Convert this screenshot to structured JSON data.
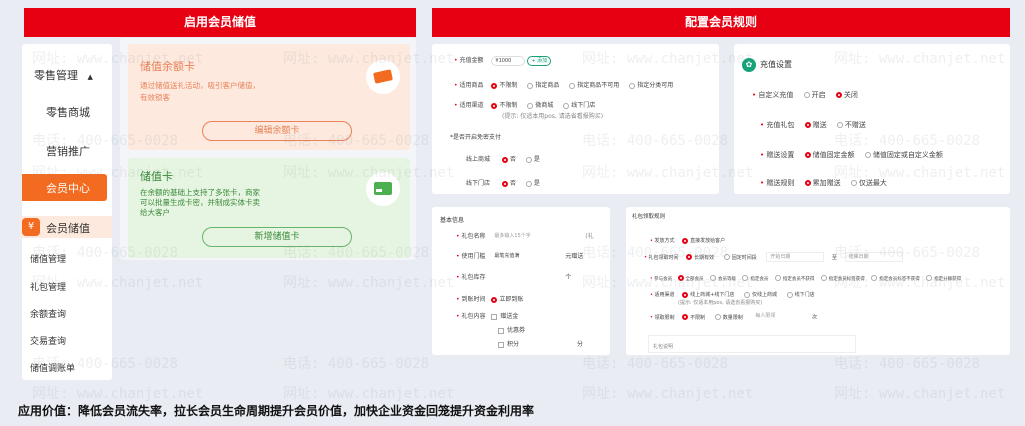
{
  "banners": {
    "left": "启用会员储值",
    "right": "配置会员规则"
  },
  "watermark": {
    "url": "网址: www.chanjet.net",
    "phone": "电话: 400-665-0028"
  },
  "sidebar": {
    "group": "零售管理",
    "items": [
      "零售商城",
      "营销推广",
      "会员中心"
    ],
    "section": "会员储值",
    "sub_items": [
      "储值管理",
      "礼包管理",
      "余额查询",
      "交易查询",
      "储值调账单"
    ]
  },
  "cards": {
    "balance": {
      "title": "储值余额卡",
      "desc1": "通过储值送礼活动，吸引客户储值，",
      "desc2": "有效锁客",
      "button": "编辑余额卡"
    },
    "stored": {
      "title": "储值卡",
      "desc1": "在余额的基础上支持了多张卡，商家",
      "desc2": "可以批量生成卡密，并制成实体卡卖",
      "desc3": "给大客户",
      "button": "新增储值卡"
    }
  },
  "recharge_form": {
    "amount_label": "充值金额",
    "amount_value": "¥1000",
    "add_label": "+ 添加",
    "goods_label": "适用商品",
    "goods_options": [
      "不限制",
      "指定商品",
      "指定商品不可用",
      "指定分类可用"
    ],
    "channel_label": "适用渠道",
    "channel_options": [
      "不限制",
      "微商城",
      "线下门店"
    ],
    "channel_tip": "(提示: 仅适本用pos, 请选省看报购买)",
    "free_pay_label": "*是否开启免密支付",
    "online_label": "线上商城",
    "offline_label": "线下门店",
    "yes": "否",
    "no": "是"
  },
  "settings": {
    "title": "充值设置",
    "custom_label": "自定义充值",
    "custom_options": [
      "开启",
      "关闭"
    ],
    "gift_label": "充值礼包",
    "gift_options": [
      "赠送",
      "不赠送"
    ],
    "gift_setting_label": "赠送设置",
    "gift_setting_options": [
      "储值固定金额",
      "储值固定或自定义金额"
    ],
    "gift_rule_label": "赠送规则",
    "gift_rule_options": [
      "累加赠送",
      "仅送最大"
    ]
  },
  "basic_info": {
    "title": "基本信息",
    "name_label": "礼包名称",
    "name_placeholder": "最多输入15个字",
    "name_hint": "(礼",
    "threshold_label": "使用门槛",
    "threshold_value": "最笔充值满",
    "threshold_unit": "元赠送",
    "stock_label": "礼包库存",
    "stock_unit": "个",
    "arrive_label": "到账时间",
    "arrive_option": "立即到账",
    "content_label": "礼包内容",
    "content_options": [
      "赠送金",
      "优惠券",
      "积分"
    ],
    "points_unit": "分"
  },
  "gift_rules": {
    "title": "礼包领取规则",
    "method_label": "发放方式",
    "method_option": "直接发放给客户",
    "valid_label": "礼包领取时间",
    "valid_options": [
      "长期有效",
      "固定时间段"
    ],
    "start_ph": "开始日期",
    "to": "至",
    "end_ph": "结束日期",
    "member_label": "参与会员",
    "member_options": [
      "全部会员",
      "会员等级",
      "指定会员",
      "指定会员不获得",
      "指定会员标签获得",
      "指定会员标签不获得",
      "指定分群获得"
    ],
    "channel_label": "适用渠道",
    "channel_options": [
      "线上商城+线下门店",
      "仅线上商城",
      "线下门店"
    ],
    "channel_tip": "(提示: 仅适本用pos, 请选省看报购买)",
    "limit_label": "领取限制",
    "limit_options": [
      "不限制",
      "数量限制"
    ],
    "limit_each": "每人限领",
    "limit_unit": "次",
    "desc_label": "礼包说明"
  },
  "footer": "应用价值：降低会员流失率，拉长会员生命周期提升会员价值，加快企业资金回笼提升资金利用率",
  "colors": {
    "brand_red": "#e60012",
    "orange": "#f36b21",
    "card_peach": "#fde9dd",
    "card_green": "#e6f5e1"
  }
}
